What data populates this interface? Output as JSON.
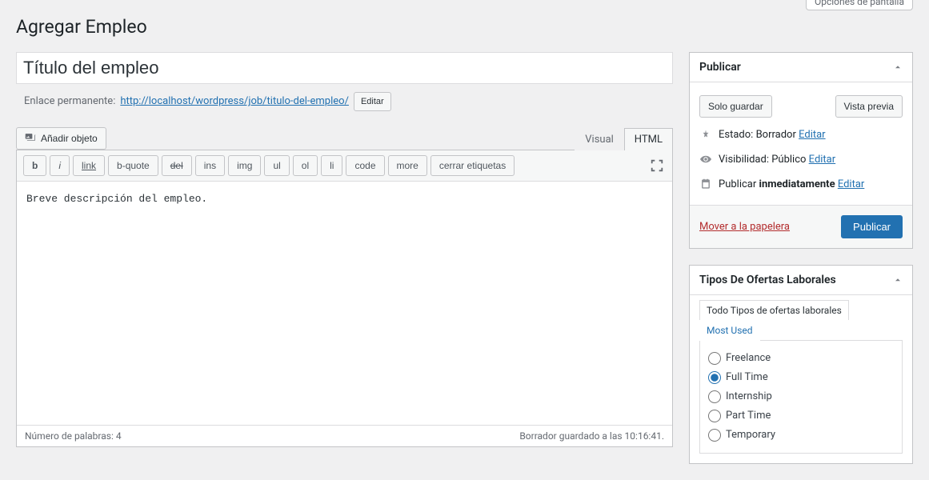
{
  "screen_options": {
    "label": "Opciones de pantalla"
  },
  "page": {
    "title": "Agregar Empleo"
  },
  "title_field": {
    "value": "Título del empleo"
  },
  "permalink": {
    "label": "Enlace permanente:",
    "url": "http://localhost/wordpress/job/titulo-del-empleo/",
    "edit": "Editar"
  },
  "media": {
    "add_object": "Añadir objeto"
  },
  "editor_tabs": {
    "visual": "Visual",
    "html": "HTML"
  },
  "quicktags": {
    "b": "b",
    "i": "i",
    "link": "link",
    "bquote": "b-quote",
    "del": "del",
    "ins": "ins",
    "img": "img",
    "ul": "ul",
    "ol": "ol",
    "li": "li",
    "code": "code",
    "more": "more",
    "close": "cerrar etiquetas"
  },
  "editor": {
    "content": "Breve descripción del empleo."
  },
  "status_bar": {
    "words_label": "Número de palabras:",
    "words_count": "4",
    "saved": "Borrador guardado a las 10:16:41."
  },
  "publish": {
    "title": "Publicar",
    "save_draft": "Solo guardar",
    "preview": "Vista previa",
    "status_label": "Estado:",
    "status_value": "Borrador",
    "visibility_label": "Visibilidad:",
    "visibility_value": "Público",
    "schedule_label": "Publicar",
    "schedule_value": "inmediatamente",
    "edit": "Editar",
    "trash": "Mover a la papelera",
    "publish_btn": "Publicar"
  },
  "jobtypes": {
    "title": "Tipos De Ofertas Laborales",
    "tab_all": "Todo Tipos de ofertas laborales",
    "tab_most_used": "Most Used",
    "options": [
      {
        "label": "Freelance",
        "checked": false
      },
      {
        "label": "Full Time",
        "checked": true
      },
      {
        "label": "Internship",
        "checked": false
      },
      {
        "label": "Part Time",
        "checked": false
      },
      {
        "label": "Temporary",
        "checked": false
      }
    ]
  }
}
